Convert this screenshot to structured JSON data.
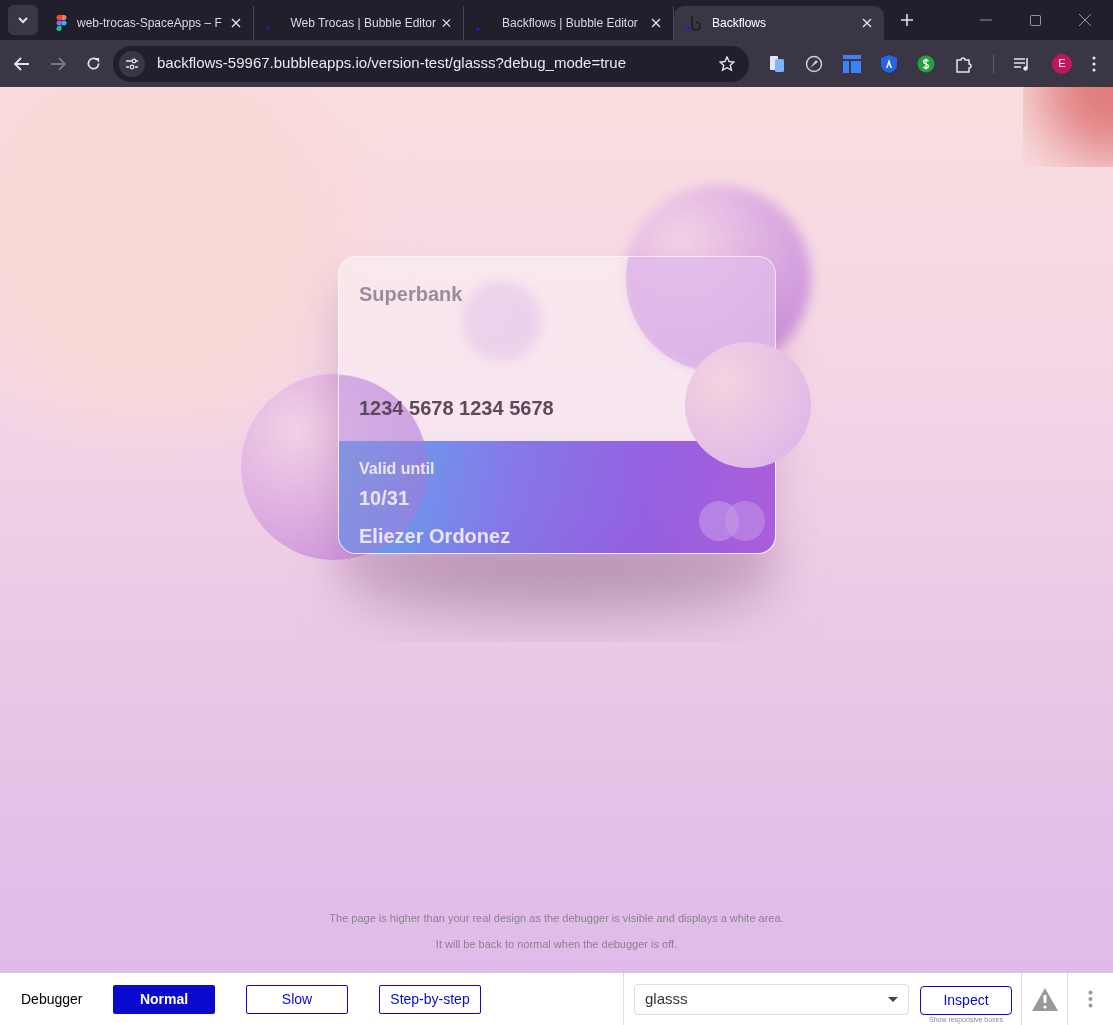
{
  "browser": {
    "tabs": [
      {
        "title": "web-trocas-SpaceApps – F",
        "kind": "figma",
        "selected": false
      },
      {
        "title": "Web Trocas | Bubble Editor",
        "kind": "bubble",
        "selected": false
      },
      {
        "title": "Backflows | Bubble Editor",
        "kind": "bubble",
        "selected": false
      },
      {
        "title": "Backflows",
        "kind": "bubble",
        "selected": true
      }
    ],
    "url": "backflows-59967.bubbleapps.io/version-test/glasss?debug_mode=true",
    "profile": "E"
  },
  "card": {
    "bank": "Superbank",
    "number": "1234 5678 1234 5678",
    "valid_label": "Valid until",
    "expiry": "10/31",
    "holder": "Eliezer Ordonez"
  },
  "notice": [
    "The page is higher than your real design as the debugger is visible and displays a white area.",
    "It will be back to normal when the debugger is off."
  ],
  "debugger": {
    "label": "Debugger",
    "modes": [
      {
        "label": "Normal",
        "selected": true
      },
      {
        "label": "Slow",
        "selected": false
      },
      {
        "label": "Step-by-step",
        "selected": false
      }
    ],
    "page": "glasss",
    "inspect": "Inspect",
    "inspect_hint": "Show responsive boxes"
  }
}
